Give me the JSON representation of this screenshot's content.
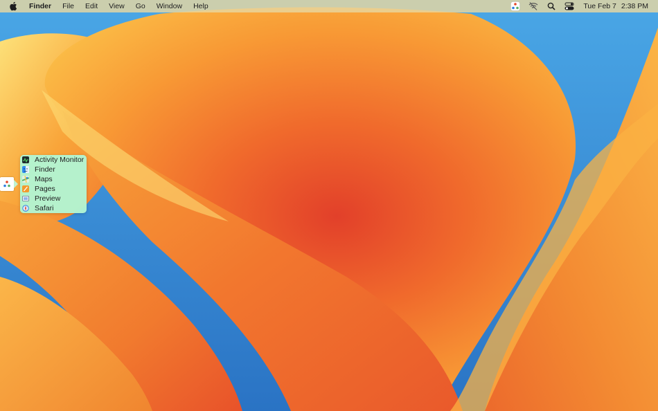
{
  "menubar": {
    "apple_icon": "apple-logo-icon",
    "app_name": "Finder",
    "menus": [
      "File",
      "Edit",
      "View",
      "Go",
      "Window",
      "Help"
    ],
    "status_icons": [
      "app-switcher-icon",
      "wifi-off-icon",
      "search-icon",
      "control-center-icon"
    ],
    "date": "Tue Feb 7",
    "time": "2:38 PM"
  },
  "app_menu": {
    "items": [
      {
        "label": "Activity Monitor",
        "icon": "activity-monitor-icon",
        "color": "#1f2a2e"
      },
      {
        "label": "Finder",
        "icon": "finder-icon",
        "color": "#2f8cf0"
      },
      {
        "label": "Maps",
        "icon": "maps-icon",
        "color": "#59b368"
      },
      {
        "label": "Pages",
        "icon": "pages-icon",
        "color": "#f29a2e"
      },
      {
        "label": "Preview",
        "icon": "preview-icon",
        "color": "#5b6e8c"
      },
      {
        "label": "Safari",
        "icon": "safari-icon",
        "color": "#2d7ee0"
      }
    ],
    "background": "#b2f5d2"
  },
  "colors": {
    "menubar": "#e8d7a0",
    "wallpaper_orange": "#f7932f",
    "wallpaper_red": "#e34527",
    "wallpaper_blue": "#2e7fcb"
  }
}
